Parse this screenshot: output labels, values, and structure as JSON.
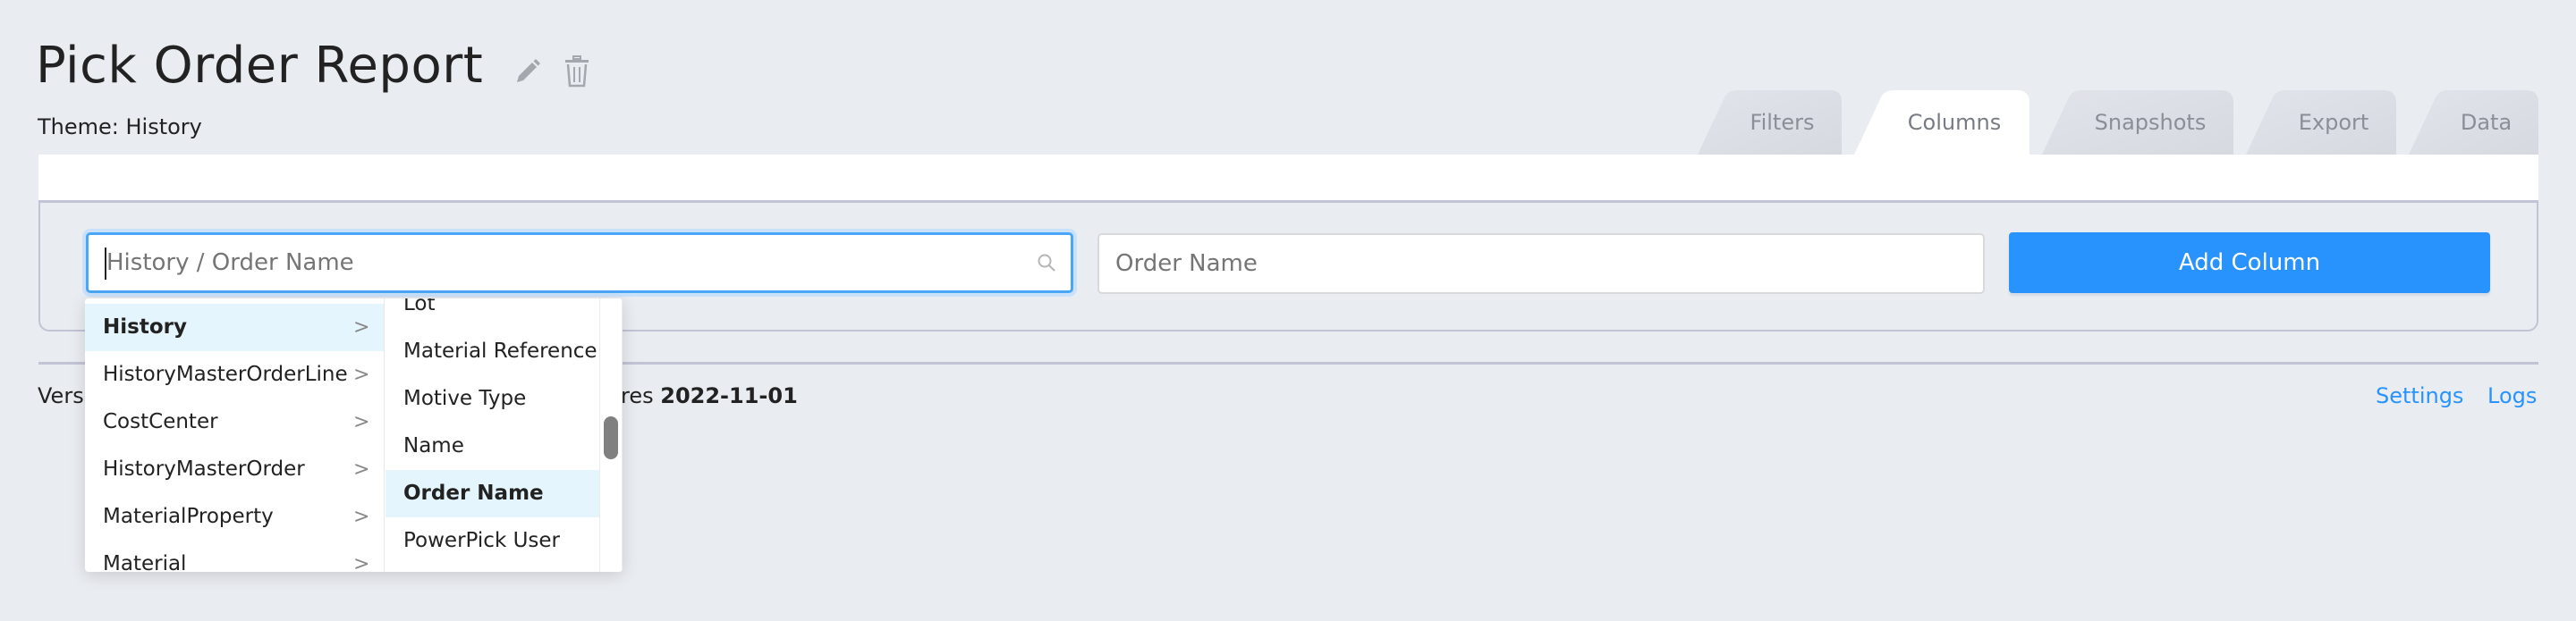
{
  "header": {
    "title": "Pick Order Report",
    "theme": "Theme: History",
    "icons": {
      "edit": "pencil-icon",
      "delete": "trash-icon"
    }
  },
  "tabs": [
    {
      "label": "Filters",
      "active": false
    },
    {
      "label": "Columns",
      "active": true
    },
    {
      "label": "Snapshots",
      "active": false
    },
    {
      "label": "Export",
      "active": false
    },
    {
      "label": "Data",
      "active": false
    }
  ],
  "columns_panel": {
    "column_search": {
      "value": "",
      "placeholder": "History / Order Name",
      "icon": "search-icon"
    },
    "column_name": {
      "value": "",
      "placeholder": "Order Name"
    },
    "add_button_label": "Add Column"
  },
  "cascader": {
    "level1": [
      {
        "label": "History",
        "selected": true
      },
      {
        "label": "HistoryMasterOrderLine",
        "selected": false
      },
      {
        "label": "CostCenter",
        "selected": false
      },
      {
        "label": "HistoryMasterOrder",
        "selected": false
      },
      {
        "label": "MaterialProperty",
        "selected": false
      },
      {
        "label": "Material",
        "selected": false
      }
    ],
    "level2": [
      {
        "label": "Lot",
        "selected": false
      },
      {
        "label": "Material Reference",
        "selected": false
      },
      {
        "label": "Motive Type",
        "selected": false
      },
      {
        "label": "Name",
        "selected": false
      },
      {
        "label": "Order Name",
        "selected": true
      },
      {
        "label": "PowerPick User",
        "selected": false
      }
    ],
    "chevron": ">"
  },
  "footer": {
    "version_visible_start": "Vers",
    "version_visible_end_prefix": "res ",
    "expiry_date": "2022-11-01",
    "links": {
      "settings": "Settings",
      "logs": "Logs"
    }
  },
  "colors": {
    "accent": "#2893fd",
    "page_bg": "#e9ecf1",
    "highlight": "#e5f5fd",
    "focus_border": "#4aa6f6"
  }
}
